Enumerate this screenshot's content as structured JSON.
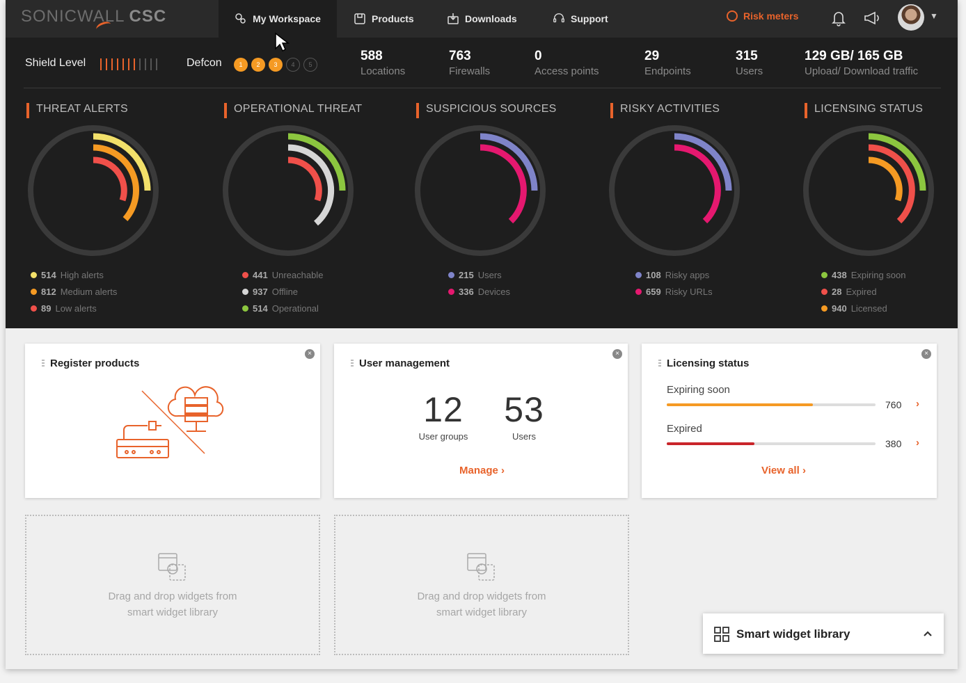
{
  "brand": {
    "name": "SONICWALL",
    "product": "CSC"
  },
  "nav": {
    "tabs": [
      {
        "label": "My Workspace",
        "icon": "workspace-icon"
      },
      {
        "label": "Products",
        "icon": "products-icon"
      },
      {
        "label": "Downloads",
        "icon": "downloads-icon"
      },
      {
        "label": "Support",
        "icon": "support-icon"
      }
    ],
    "risk_meters": "Risk meters"
  },
  "status": {
    "shield_label": "Shield Level",
    "shield_level": 7,
    "shield_total": 11,
    "defcon_label": "Defcon",
    "defcon": [
      "1",
      "2",
      "3",
      "4",
      "5"
    ],
    "defcon_active": 3
  },
  "stats": [
    {
      "value": "588",
      "label": "Locations"
    },
    {
      "value": "763",
      "label": "Firewalls"
    },
    {
      "value": "0",
      "label": "Access points"
    },
    {
      "value": "29",
      "label": "Endpoints"
    },
    {
      "value": "315",
      "label": "Users"
    },
    {
      "value": "129 GB/ 165 GB",
      "label": "Upload/ Download traffic"
    }
  ],
  "meters": [
    {
      "title": "THREAT ALERTS",
      "items": [
        {
          "value": "514",
          "label": "High alerts",
          "color": "#f2e06a"
        },
        {
          "value": "812",
          "label": "Medium alerts",
          "color": "#f59a23"
        },
        {
          "value": "89",
          "label": "Low alerts",
          "color": "#f0504a"
        }
      ]
    },
    {
      "title": "OPERATIONAL THREAT",
      "items": [
        {
          "value": "441",
          "label": "Unreachable",
          "color": "#f0504a"
        },
        {
          "value": "937",
          "label": "Offline",
          "color": "#d6d6d6"
        },
        {
          "value": "514",
          "label": "Operational",
          "color": "#8cc63f"
        }
      ]
    },
    {
      "title": "SUSPICIOUS SOURCES",
      "items": [
        {
          "value": "215",
          "label": "Users",
          "color": "#7f84c9"
        },
        {
          "value": "336",
          "label": "Devices",
          "color": "#e5186f"
        }
      ]
    },
    {
      "title": "RISKY ACTIVITIES",
      "items": [
        {
          "value": "108",
          "label": "Risky apps",
          "color": "#7f84c9"
        },
        {
          "value": "659",
          "label": "Risky URLs",
          "color": "#e5186f"
        }
      ]
    },
    {
      "title": "LICENSING STATUS",
      "items": [
        {
          "value": "438",
          "label": "Expiring soon",
          "color": "#8cc63f"
        },
        {
          "value": "28",
          "label": "Expired",
          "color": "#f0504a"
        },
        {
          "value": "940",
          "label": "Licensed",
          "color": "#f59a23"
        }
      ]
    }
  ],
  "widgets": {
    "register": {
      "title": "Register products"
    },
    "users": {
      "title": "User management",
      "groups_value": "12",
      "groups_label": "User groups",
      "users_value": "53",
      "users_label": "Users",
      "manage": "Manage"
    },
    "licensing": {
      "title": "Licensing status",
      "expiring_label": "Expiring soon",
      "expiring_value": "760",
      "expiring_fraction": 0.7,
      "expired_label": "Expired",
      "expired_value": "380",
      "expired_fraction": 0.42,
      "view_all": "View all"
    },
    "dropzone": {
      "line1": "Drag and drop widgets from",
      "line2": "smart widget library"
    }
  },
  "library": {
    "label": "Smart widget library"
  }
}
